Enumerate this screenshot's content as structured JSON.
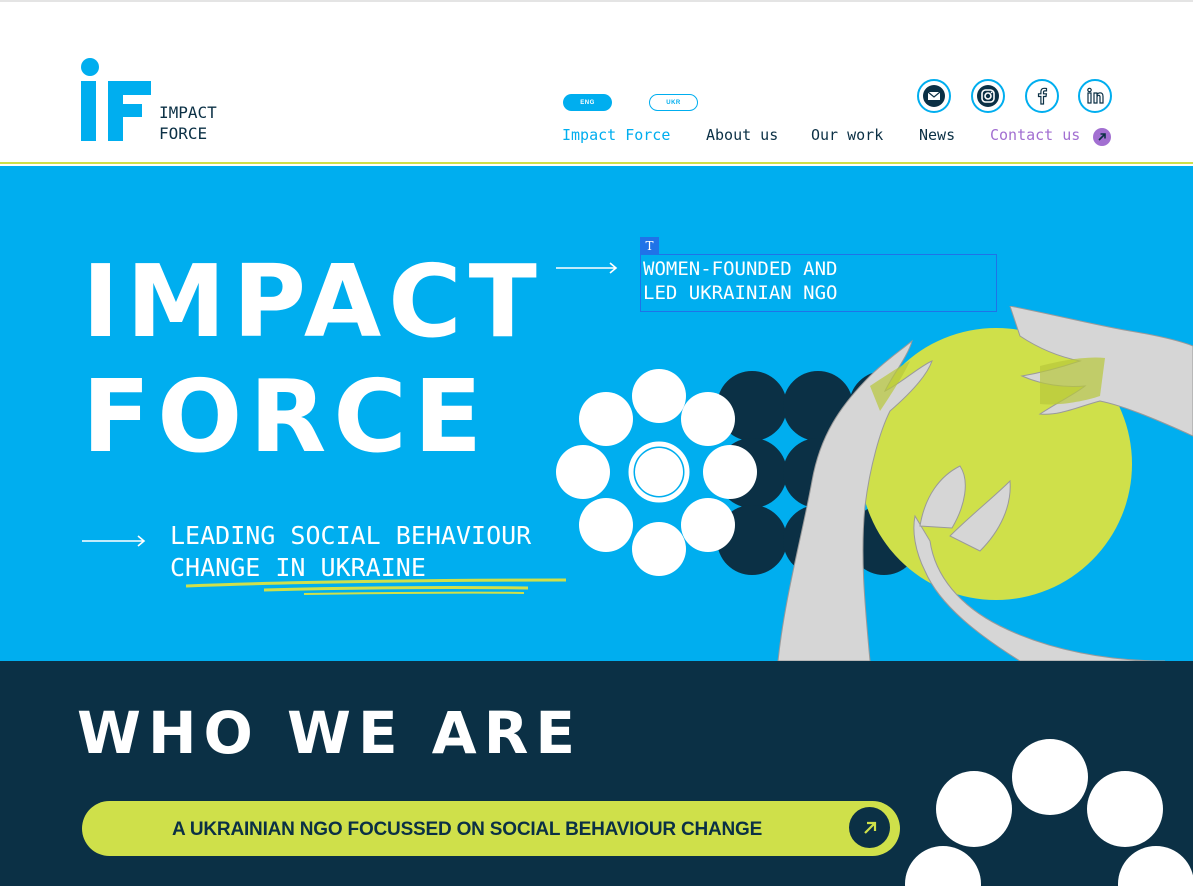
{
  "header": {
    "logo_line1": "IMPACT",
    "logo_line2": "FORCE",
    "lang": {
      "eng": "ENG",
      "ukr": "UKR"
    },
    "nav": {
      "impact_force": "Impact Force",
      "about_us": "About us",
      "our_work": "Our work",
      "news": "News",
      "contact_us": "Contact us"
    },
    "social_icons": [
      "mail-icon",
      "instagram-icon",
      "facebook-icon",
      "linkedin-icon"
    ]
  },
  "hero": {
    "title_line1": "IMPACT",
    "title_line2": "FORCE",
    "tag_marker": "T",
    "tagline_line1": "WOMEN-FOUNDED AND",
    "tagline_line2": "LED UKRAINIAN NGO",
    "subtitle_line1": "LEADING SOCIAL BEHAVIOUR",
    "subtitle_line2": "CHANGE IN UKRAINE"
  },
  "who": {
    "title": "WHO WE ARE",
    "pill_text": "A UKRAINIAN NGO  FOCUSSED ON SOCIAL  BEHAVIOUR CHANGE"
  },
  "colors": {
    "brand_blue": "#00aeef",
    "navy": "#0b3045",
    "lime": "#cfe04a",
    "purple": "#a26fd1"
  }
}
